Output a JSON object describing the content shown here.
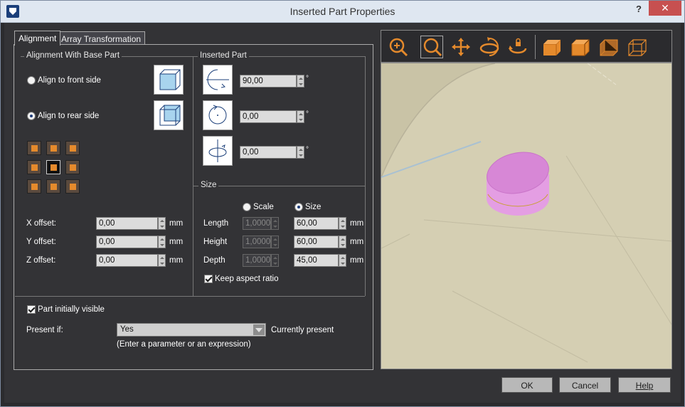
{
  "window": {
    "title": "Inserted Part Properties",
    "help_glyph": "?",
    "close_glyph": "✕"
  },
  "tabs": [
    {
      "label": "Alignment"
    },
    {
      "label": "Array Transformation"
    }
  ],
  "alignment_group": {
    "title": "Alignment With Base Part",
    "front_label": "Align to front side",
    "rear_label": "Align to rear side",
    "selected": "rear"
  },
  "offsets": {
    "x_label": "X offset:",
    "x_value": "0,00",
    "y_label": "Y offset:",
    "y_value": "0,00",
    "z_label": "Z offset:",
    "z_value": "0,00",
    "unit": "mm"
  },
  "inserted_part": {
    "title": "Inserted Part",
    "rot1": "90,00",
    "rot2": "0,00",
    "rot3": "0,00",
    "degree": "°"
  },
  "size": {
    "title": "Size",
    "scale_label": "Scale",
    "size_label": "Size",
    "mode": "size",
    "length_label": "Length",
    "height_label": "Height",
    "depth_label": "Depth",
    "length_scale": "1,0000",
    "height_scale": "1,0000",
    "depth_scale": "1,0000",
    "length": "60,00",
    "height": "60,00",
    "depth": "45,00",
    "unit": "mm",
    "keep_aspect_label": "Keep aspect ratio",
    "keep_aspect": true
  },
  "visibility": {
    "initially_visible_label": "Part initially visible",
    "initially_visible": true,
    "present_if_label": "Present if:",
    "present_if_value": "Yes",
    "status": "Currently present",
    "hint": "(Enter a parameter or an expression)"
  },
  "toolbar": [
    {
      "icon": "zoom-in-icon"
    },
    {
      "icon": "zoom-fit-icon"
    },
    {
      "icon": "pan-icon"
    },
    {
      "icon": "rotate-3d-icon"
    },
    {
      "icon": "rotate-locked-icon"
    },
    {
      "icon": "shaded-cube-icon"
    },
    {
      "icon": "shaded-edges-cube-icon"
    },
    {
      "icon": "transparent-cube-icon"
    },
    {
      "icon": "wireframe-cube-icon"
    }
  ],
  "accent_color": "#e58a2c",
  "footer": {
    "ok": "OK",
    "cancel": "Cancel",
    "help": "Help"
  }
}
